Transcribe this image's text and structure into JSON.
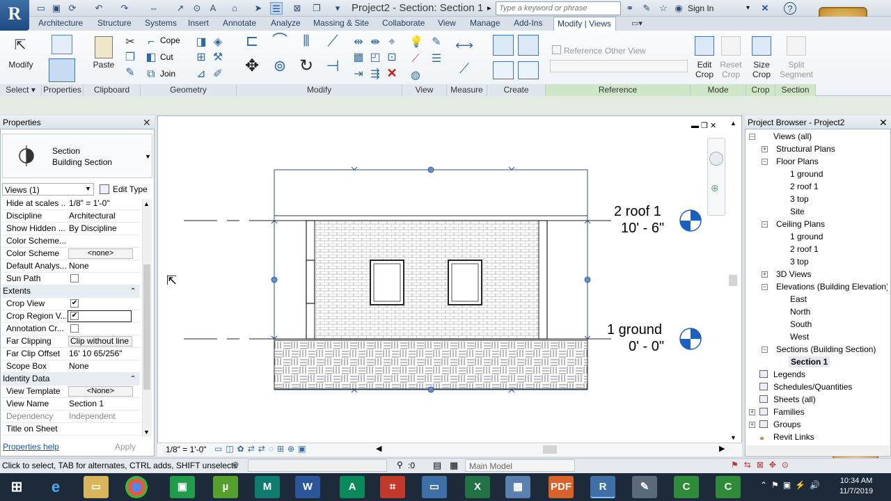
{
  "titlebar": {
    "app_letter": "R",
    "document_title": "Project2 - Section: Section 1",
    "search_placeholder": "Type a keyword or phrase",
    "sign_in": "Sign In"
  },
  "ribbon_tabs": [
    "Architecture",
    "Structure",
    "Systems",
    "Insert",
    "Annotate",
    "Analyze",
    "Massing & Site",
    "Collaborate",
    "View",
    "Manage",
    "Add-Ins"
  ],
  "active_tab": "Modify | Views",
  "ribbon": {
    "modify": "Modify",
    "paste": "Paste",
    "cope": "Cope",
    "cut": "Cut",
    "join": "Join",
    "reference_other_view": "Reference Other View",
    "edit_crop": [
      "Edit",
      "Crop"
    ],
    "reset_crop": [
      "Reset",
      "Crop"
    ],
    "size_crop": [
      "Size",
      "Crop"
    ],
    "split_segment": [
      "Split",
      "Segment"
    ],
    "panels": [
      "Select",
      "Properties",
      "Clipboard",
      "Geometry",
      "Modify",
      "View",
      "Measure",
      "Create",
      "Reference",
      "Mode",
      "Crop",
      "Section"
    ]
  },
  "properties": {
    "title": "Properties",
    "type_line1": "Section",
    "type_line2": "Building Section",
    "views_selector": "Views (1)",
    "edit_type": "Edit Type",
    "rows": [
      {
        "name": "Hide at scales ...",
        "value": "1/8\" = 1'-0\""
      },
      {
        "name": "Discipline",
        "value": "Architectural"
      },
      {
        "name": "Show Hidden ...",
        "value": "By Discipline"
      },
      {
        "name": "Color Scheme...",
        "value": ""
      },
      {
        "name": "Color Scheme",
        "value": "<none>"
      },
      {
        "name": "Default Analys...",
        "value": "None"
      },
      {
        "name": "Sun Path",
        "value": ""
      },
      {
        "name": "Extents",
        "value": ""
      },
      {
        "name": "Crop View",
        "value": ""
      },
      {
        "name": "Crop Region V...",
        "value": ""
      },
      {
        "name": "Annotation Cr...",
        "value": ""
      },
      {
        "name": "Far Clipping",
        "value": "Clip without line"
      },
      {
        "name": "Far Clip Offset",
        "value": "16'  10 65/256\""
      },
      {
        "name": "Scope Box",
        "value": "None"
      },
      {
        "name": "Identity Data",
        "value": ""
      },
      {
        "name": "View Template",
        "value": "<None>"
      },
      {
        "name": "View Name",
        "value": "Section 1"
      },
      {
        "name": "Dependency",
        "value": "Independent"
      },
      {
        "name": "Title on Sheet",
        "value": ""
      }
    ],
    "checks": {
      "sun_path": false,
      "crop_view": true,
      "crop_region_visible": true,
      "annotation_crop": false
    },
    "help_link": "Properties help",
    "apply": "Apply"
  },
  "canvas": {
    "level_top_name": "2 roof 1",
    "level_top_elev": "10' - 6\"",
    "level_bottom_name": "1 ground",
    "level_bottom_elev": "0' - 0\"",
    "scale": "1/8\" = 1'-0\""
  },
  "project_browser": {
    "title": "Project Browser - Project2",
    "items": [
      {
        "label": "Views (all)",
        "level": 0,
        "toggle": "-"
      },
      {
        "label": "Structural Plans",
        "level": 1,
        "toggle": "+"
      },
      {
        "label": "Floor Plans",
        "level": 1,
        "toggle": "-"
      },
      {
        "label": "1 ground",
        "level": 2,
        "toggle": ""
      },
      {
        "label": "2 roof 1",
        "level": 2,
        "toggle": ""
      },
      {
        "label": "3 top",
        "level": 2,
        "toggle": ""
      },
      {
        "label": "Site",
        "level": 2,
        "toggle": ""
      },
      {
        "label": "Ceiling Plans",
        "level": 1,
        "toggle": "-"
      },
      {
        "label": "1 ground",
        "level": 2,
        "toggle": ""
      },
      {
        "label": "2 roof 1",
        "level": 2,
        "toggle": ""
      },
      {
        "label": "3 top",
        "level": 2,
        "toggle": ""
      },
      {
        "label": "3D Views",
        "level": 1,
        "toggle": "+"
      },
      {
        "label": "Elevations (Building Elevation)",
        "level": 1,
        "toggle": "-"
      },
      {
        "label": "East",
        "level": 2,
        "toggle": ""
      },
      {
        "label": "North",
        "level": 2,
        "toggle": ""
      },
      {
        "label": "South",
        "level": 2,
        "toggle": ""
      },
      {
        "label": "West",
        "level": 2,
        "toggle": ""
      },
      {
        "label": "Sections (Building Section)",
        "level": 1,
        "toggle": "-"
      },
      {
        "label": "Section 1",
        "level": 2,
        "toggle": "",
        "selected": true
      },
      {
        "label": "Legends",
        "level": 0,
        "toggle": ""
      },
      {
        "label": "Schedules/Quantities",
        "level": 0,
        "toggle": ""
      },
      {
        "label": "Sheets (all)",
        "level": 0,
        "toggle": ""
      },
      {
        "label": "Families",
        "level": 0,
        "toggle": "+"
      },
      {
        "label": "Groups",
        "level": 0,
        "toggle": "+"
      },
      {
        "label": "Revit Links",
        "level": 0,
        "toggle": ""
      }
    ]
  },
  "statusbar": {
    "text": "Click to select, TAB for alternates, CTRL adds, SHIFT unselects",
    "count": ":0",
    "model": "Main Model"
  },
  "taskbar": {
    "time": "10:34 AM",
    "date": "11/7/2019"
  },
  "colors": {
    "accent": "#1f3f66",
    "level_marker": "#1a5fc4",
    "crop_line": "#2b5aa8"
  }
}
